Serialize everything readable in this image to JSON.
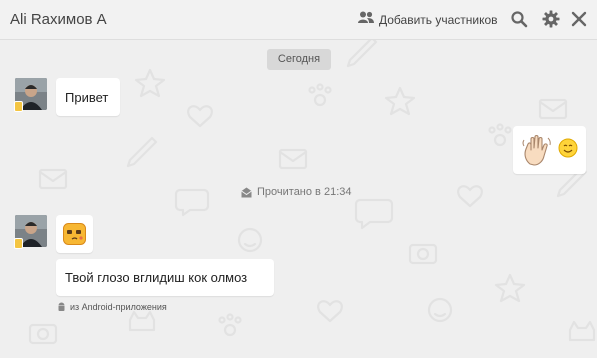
{
  "header": {
    "title": "Ali Raxимов A",
    "add_members_label": "Добавить участников",
    "icons": [
      "add-members-icon",
      "search-icon",
      "settings-icon",
      "close-icon"
    ]
  },
  "chat": {
    "date_badge": "Сегодня",
    "read_status": "Прочитано в 21:34",
    "messages": [
      {
        "sender": "contact",
        "text": "Привет"
      },
      {
        "sender": "me",
        "stickers": [
          "waving-hand-sticker",
          "smiley-sticker"
        ]
      },
      {
        "sender": "contact",
        "stickers": [
          "blushing-face-sticker"
        ]
      },
      {
        "sender": "contact",
        "text": "Твой глозо  вглидиш кок олмоз",
        "source": "из Android-приложения"
      }
    ]
  },
  "colors": {
    "background": "#efefef",
    "bubble": "#ffffff",
    "mobile_badge": "#f4c542",
    "icon_gray": "#666666"
  }
}
